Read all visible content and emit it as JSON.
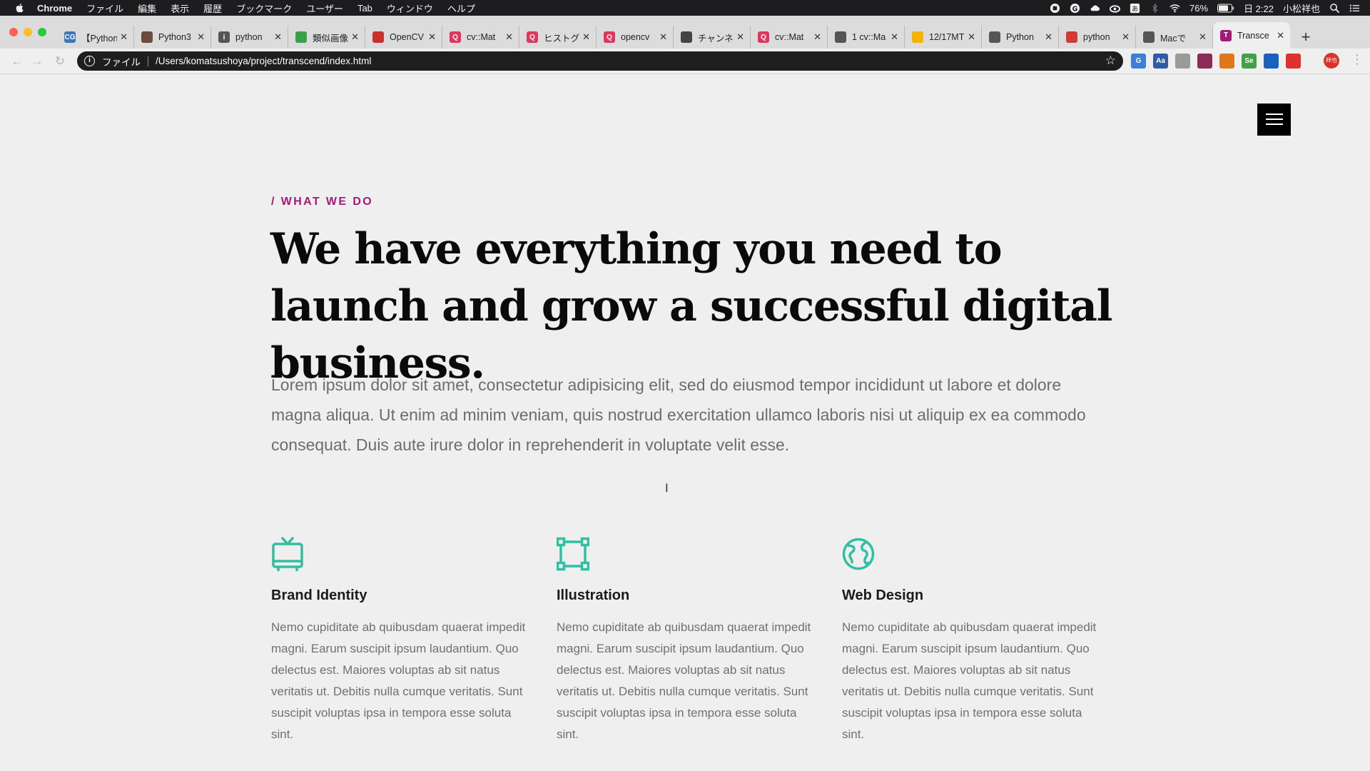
{
  "menubar": {
    "items": [
      "Chrome",
      "ファイル",
      "編集",
      "表示",
      "履歴",
      "ブックマーク",
      "ユーザー",
      "Tab",
      "ウィンドウ",
      "ヘルプ"
    ],
    "battery": "76%",
    "clock": "日 2:22",
    "user": "小松祥也",
    "status_icons": [
      "record-icon",
      "grammarly-icon",
      "cloud-icon",
      "creative-cloud-icon",
      "input-method-icon",
      "bluetooth-icon",
      "wifi-icon",
      "battery-icon",
      "spotlight-icon",
      "notification-center-icon"
    ]
  },
  "tabs": [
    {
      "title": "【Python",
      "icon": "cg-logo",
      "color": "#3a76b8",
      "glyph": "CG"
    },
    {
      "title": "Python3",
      "icon": "avatar-favicon",
      "color": "#6b4b3e",
      "glyph": ""
    },
    {
      "title": "python",
      "icon": "info-favicon",
      "color": "#555555",
      "glyph": "i"
    },
    {
      "title": "類似画像",
      "icon": "green-favicon",
      "color": "#3aa04a",
      "glyph": ""
    },
    {
      "title": "OpenCV",
      "icon": "opencv-logo",
      "color": "#c8312b",
      "glyph": ""
    },
    {
      "title": "cv::Mat",
      "icon": "qiita-favicon",
      "color": "#e0365b",
      "glyph": "Q"
    },
    {
      "title": "ヒストグ",
      "icon": "qiita-favicon",
      "color": "#e0365b",
      "glyph": "Q"
    },
    {
      "title": "opencv",
      "icon": "qiita-favicon",
      "color": "#e0365b",
      "glyph": "Q"
    },
    {
      "title": "チャンネ",
      "icon": "bird-favicon",
      "color": "#444444",
      "glyph": ""
    },
    {
      "title": "cv::Mat",
      "icon": "qiita-favicon",
      "color": "#e0365b",
      "glyph": "Q"
    },
    {
      "title": "1 cv::Ma",
      "icon": "globe-favicon",
      "color": "#555555",
      "glyph": ""
    },
    {
      "title": "12/17MT",
      "icon": "slides-favicon",
      "color": "#f3b400",
      "glyph": ""
    },
    {
      "title": "Python",
      "icon": "globe-favicon",
      "color": "#555555",
      "glyph": ""
    },
    {
      "title": "python",
      "icon": "book-favicon",
      "color": "#d23a36",
      "glyph": ""
    },
    {
      "title": "Macで",
      "icon": "apple-favicon",
      "color": "#555555",
      "glyph": ""
    },
    {
      "title": "Transce",
      "icon": "transcend-favicon",
      "color": "#a4197a",
      "glyph": "T",
      "active": true
    }
  ],
  "address": {
    "scheme": "ファイル",
    "url": "/Users/komatsushoya/project/transcend/index.html"
  },
  "extensions": [
    {
      "icon": "translate-icon",
      "color": "#3e7ed8",
      "glyph": "G"
    },
    {
      "icon": "dictionary-icon",
      "color": "#2f5aa8",
      "glyph": "Aa"
    },
    {
      "icon": "screen-capture-icon",
      "color": "#9a9a9a",
      "glyph": ""
    },
    {
      "icon": "qr-code-icon",
      "color": "#8a2b5a",
      "glyph": ""
    },
    {
      "icon": "metamask-fox-icon",
      "color": "#e2761b",
      "glyph": ""
    },
    {
      "icon": "selenium-icon",
      "color": "#43a047",
      "glyph": "Se"
    },
    {
      "icon": "compass-icon",
      "color": "#1b5fbf",
      "glyph": ""
    },
    {
      "icon": "youtube-icon",
      "color": "#e03030",
      "glyph": ""
    }
  ],
  "profile": {
    "initials": "祥也"
  },
  "page": {
    "eyebrow": "/ WHAT WE DO",
    "headline": "We have everything you need to launch and grow a successful digital business.",
    "lead": "Lorem ipsum dolor sit amet, consectetur adipisicing elit, sed do eiusmod tempor incididunt ut labore et dolore magna aliqua. Ut enim ad minim veniam, quis nostrud exercitation ullamco laboris nisi ut aliquip ex ea commodo consequat. Duis aute irure dolor in reprehenderit in voluptate velit esse.",
    "services": [
      {
        "title": "Brand Identity",
        "icon": "tv-icon",
        "text": "Nemo cupiditate ab quibusdam quaerat impedit magni. Earum suscipit ipsum laudantium. Quo delectus est. Maiores voluptas ab sit natus veritatis ut. Debitis nulla cumque veritatis. Sunt suscipit voluptas ipsa in tempora esse soluta sint."
      },
      {
        "title": "Illustration",
        "icon": "bounding-box-icon",
        "text": "Nemo cupiditate ab quibusdam quaerat impedit magni. Earum suscipit ipsum laudantium. Quo delectus est. Maiores voluptas ab sit natus veritatis ut. Debitis nulla cumque veritatis. Sunt suscipit voluptas ipsa in tempora esse soluta sint."
      },
      {
        "title": "Web Design",
        "icon": "globe-icon",
        "text": "Nemo cupiditate ab quibusdam quaerat impedit magni. Earum suscipit ipsum laudantium. Quo delectus est. Maiores voluptas ab sit natus veritatis ut. Debitis nulla cumque veritatis. Sunt suscipit voluptas ipsa in tempora esse soluta sint."
      }
    ]
  },
  "colors": {
    "accent": "#a4197a",
    "icon_teal": "#2fbfa2",
    "menubar": "#1d1d1f",
    "omnibox": "#1e1e1e"
  }
}
